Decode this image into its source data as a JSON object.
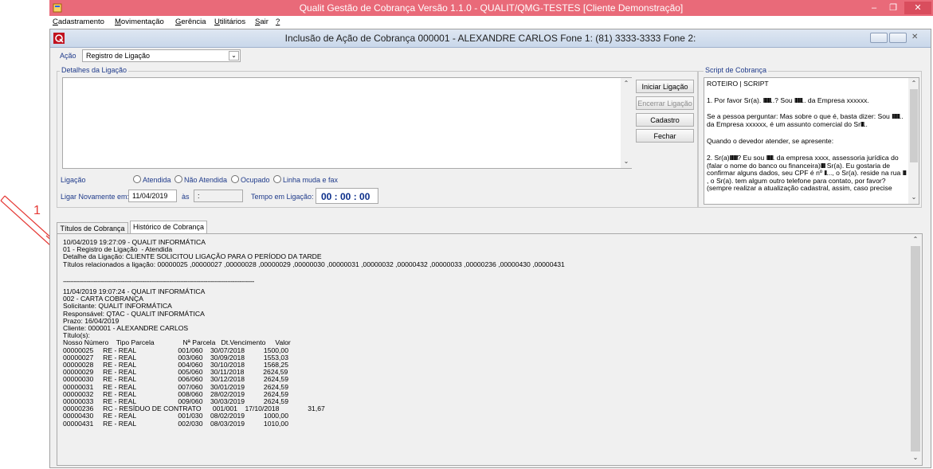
{
  "window": {
    "title": "Qualit Gestão de Cobrança Versão 1.1.0 - QUALIT/QMG-TESTES [Cliente Demonstração]"
  },
  "menu": [
    {
      "label": "Cadastramento"
    },
    {
      "label": "Movimentação"
    },
    {
      "label": "Gerência"
    },
    {
      "label": "Utilitários"
    },
    {
      "label": "Sair"
    },
    {
      "label": "?"
    }
  ],
  "form": {
    "title": "Inclusão de Ação de Cobrança   000001 - ALEXANDRE CARLOS  Fone 1: (81) 3333-3333 Fone 2:",
    "acao_label": "Ação",
    "acao_value": "Registro de Ligação",
    "detalhes_group": "Detalhes da Ligação",
    "ligacao_label": "Ligação",
    "radios": [
      "Atendida",
      "Não Atendida",
      "Ocupado",
      "Linha muda e fax"
    ],
    "ligar_novamente_label": "Ligar Novamente em:",
    "ligar_date": "11/04/2019",
    "as_label": "às",
    "ligar_time": " :",
    "tempo_label": "Tempo em Ligação:",
    "tempo_value": "00 : 00 : 00",
    "buttons": {
      "iniciar": "Iniciar Ligação",
      "encerrar": "Encerrar Ligação",
      "cadastro": "Cadastro",
      "fechar": "Fechar"
    },
    "script_group": "Script de Cobrança",
    "script": {
      "heading": "ROTEIRO | SCRIPT",
      "p1a": "1. Por favor Sr(a). ",
      "p1b": "..? Sou ",
      "p1c": ".. da Empresa xxxxxx.",
      "p2a": "Se a pessoa perguntar: Mas sobre o que é, basta dizer: Sou ",
      "p2b": ".. da Empresa xxxxxx, é um assunto comercial do Sr",
      "p2c": "..",
      "p3": "Quando o devedor atender, se apresente:",
      "p4a": "2. Sr(a)",
      "p4b": "? Eu sou ",
      "p4c": ". da empresa xxxx, assessoria jurídica do (falar o nome do banco ou financeira)",
      "p4d": " Sr(a). Eu gostaria de confirmar alguns dados, seu CPF é nº ",
      "p4e": "..., o Sr(a). reside na rua ",
      "p4f": ", o Sr(a). tem algum outro telefone para contato, por favor? (sempre realizar a atualização cadastral, assim, caso precise"
    },
    "tabs": [
      "Títulos de Cobrança",
      "Histórico de Cobrança"
    ],
    "annotation": "1"
  },
  "history": {
    "entry1": [
      "10/04/2019 19:27:09 - QUALIT INFORMÁTICA",
      "01 - Registro de Ligação  - Atendida",
      "Detalhe da Ligação: CLIENTE SOLICITOU LIGAÇÃO PARA O PERÍODO DA TARDE",
      "Títulos relacionados a ligação: 00000025 ,00000027 ,00000028 ,00000029 ,00000030 ,00000031 ,00000032 ,00000432 ,00000033 ,00000236 ,00000430 ,00000431"
    ],
    "separator": "----------------------------------------------------------------------------------------------------------",
    "entry2": [
      "11/04/2019 19:07:24 - QUALIT INFORMÁTICA",
      "002 - CARTA COBRANÇA",
      "Solicitante: QUALIT INFORMÁTICA",
      "Responsável: QTAC - QUALIT INFORMÁTICA",
      "Prazo: 16/04/2019",
      "Cliente: 000001 - ALEXANDRE CARLOS",
      "Título(s):"
    ],
    "table_header": "Nosso Número    Tipo Parcela               Nª Parcela   Dt.Vencimento     Valor",
    "table_rows": [
      "00000025     RE - REAL                      001/060    30/07/2018          1500,00",
      "00000027     RE - REAL                      003/060    30/09/2018          1553,03",
      "00000028     RE - REAL                      004/060    30/10/2018          1568,25",
      "00000029     RE - REAL                      005/060    30/11/2018          2624,59",
      "00000030     RE - REAL                      006/060    30/12/2018          2624,59",
      "00000031     RE - REAL                      007/060    30/01/2019          2624,59",
      "00000032     RE - REAL                      008/060    28/02/2019          2624,59",
      "00000033     RE - REAL                      009/060    30/03/2019          2624,59",
      "00000236     RC - RESÍDUO DE CONTRATO      001/001    17/10/2018               31,67",
      "00000430     RE - REAL                      001/030    08/02/2019          1000,00",
      "00000431     RE - REAL                      002/030    08/03/2019          1010,00"
    ]
  },
  "colors": {
    "titlebar": "#e96a79",
    "label_blue": "#1e3a8a",
    "timer_blue": "#0b2e8a",
    "annotation_red": "#e53935"
  }
}
